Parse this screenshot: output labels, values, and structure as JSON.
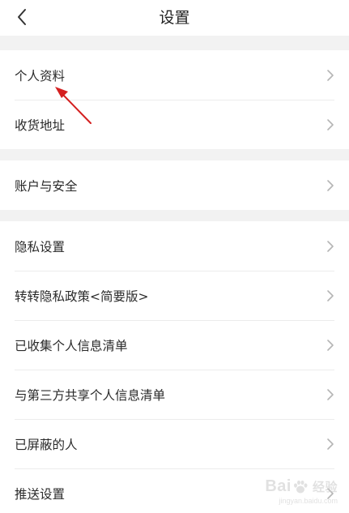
{
  "nav": {
    "title": "设置",
    "back_icon": "chevron-left-icon"
  },
  "colors": {
    "divider_band": "#f2f2f2",
    "chevron": "#b5b5b5",
    "annotation_arrow": "#d42020"
  },
  "groups": [
    {
      "items": [
        {
          "label": "个人资料"
        },
        {
          "label": "收货地址"
        }
      ]
    },
    {
      "items": [
        {
          "label": "账户与安全"
        }
      ]
    },
    {
      "items": [
        {
          "label": "隐私设置"
        },
        {
          "label": "转转隐私政策<简要版>"
        },
        {
          "label": "已收集个人信息清单"
        },
        {
          "label": "与第三方共享个人信息清单"
        },
        {
          "label": "已屏蔽的人"
        },
        {
          "label": "推送设置"
        }
      ]
    }
  ],
  "watermark": {
    "brand_left": "Bai",
    "brand_right": "经验",
    "paw_icon": "baidu-paw-icon",
    "url": "jingyan.baidu.com"
  }
}
